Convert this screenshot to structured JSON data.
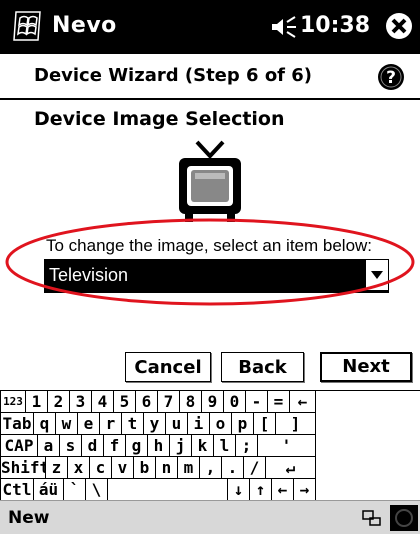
{
  "titlebar": {
    "app_title": "Nevo",
    "time": "10:38"
  },
  "wizard": {
    "title": "Device Wizard (Step 6 of 6)"
  },
  "section": {
    "title": "Device Image Selection"
  },
  "instruction": "To change the image, select an item below:",
  "image_select": {
    "value": "Television"
  },
  "buttons": {
    "cancel": "Cancel",
    "back": "Back",
    "next": "Next"
  },
  "keyboard": {
    "rows": [
      [
        "123",
        "1",
        "2",
        "3",
        "4",
        "5",
        "6",
        "7",
        "8",
        "9",
        "0",
        "-",
        "=",
        "←"
      ],
      [
        "Tab",
        "q",
        "w",
        "e",
        "r",
        "t",
        "y",
        "u",
        "i",
        "o",
        "p",
        "[",
        "]"
      ],
      [
        "CAP",
        "a",
        "s",
        "d",
        "f",
        "g",
        "h",
        "j",
        "k",
        "l",
        ";",
        "'"
      ],
      [
        "Shift",
        "z",
        "x",
        "c",
        "v",
        "b",
        "n",
        "m",
        ",",
        ".",
        "/",
        "↵"
      ],
      [
        "Ctl",
        "áü",
        "`",
        "\\",
        "",
        "↓",
        "↑",
        "←",
        "→"
      ]
    ]
  },
  "bottombar": {
    "menu_new": "New"
  },
  "colors": {
    "highlight_ellipse": "#e0141e",
    "titlebar_bg": "#000000",
    "selection_bg": "#000000"
  },
  "icons": {
    "start": "windows-flag-icon",
    "speaker": "speaker-icon",
    "close": "close-icon",
    "help": "help-icon",
    "tv": "television-icon",
    "dropdown": "chevron-down-icon",
    "keyboard": "keyboard-icon"
  }
}
